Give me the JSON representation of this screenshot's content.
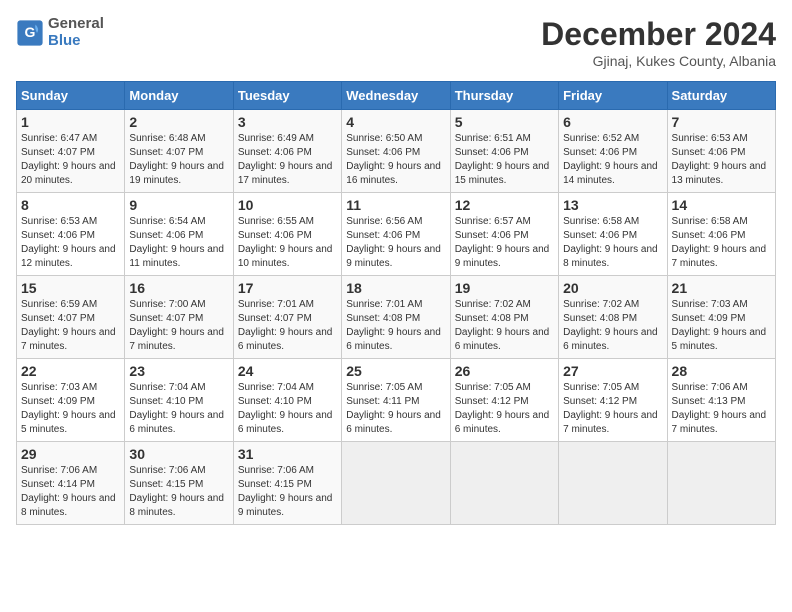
{
  "header": {
    "logo_line1": "General",
    "logo_line2": "Blue",
    "main_title": "December 2024",
    "subtitle": "Gjinaj, Kukes County, Albania"
  },
  "days_of_week": [
    "Sunday",
    "Monday",
    "Tuesday",
    "Wednesday",
    "Thursday",
    "Friday",
    "Saturday"
  ],
  "weeks": [
    [
      {
        "num": "1",
        "rise": "6:47 AM",
        "set": "4:07 PM",
        "daylight": "9 hours and 20 minutes."
      },
      {
        "num": "2",
        "rise": "6:48 AM",
        "set": "4:07 PM",
        "daylight": "9 hours and 19 minutes."
      },
      {
        "num": "3",
        "rise": "6:49 AM",
        "set": "4:06 PM",
        "daylight": "9 hours and 17 minutes."
      },
      {
        "num": "4",
        "rise": "6:50 AM",
        "set": "4:06 PM",
        "daylight": "9 hours and 16 minutes."
      },
      {
        "num": "5",
        "rise": "6:51 AM",
        "set": "4:06 PM",
        "daylight": "9 hours and 15 minutes."
      },
      {
        "num": "6",
        "rise": "6:52 AM",
        "set": "4:06 PM",
        "daylight": "9 hours and 14 minutes."
      },
      {
        "num": "7",
        "rise": "6:53 AM",
        "set": "4:06 PM",
        "daylight": "9 hours and 13 minutes."
      }
    ],
    [
      {
        "num": "8",
        "rise": "6:53 AM",
        "set": "4:06 PM",
        "daylight": "9 hours and 12 minutes."
      },
      {
        "num": "9",
        "rise": "6:54 AM",
        "set": "4:06 PM",
        "daylight": "9 hours and 11 minutes."
      },
      {
        "num": "10",
        "rise": "6:55 AM",
        "set": "4:06 PM",
        "daylight": "9 hours and 10 minutes."
      },
      {
        "num": "11",
        "rise": "6:56 AM",
        "set": "4:06 PM",
        "daylight": "9 hours and 9 minutes."
      },
      {
        "num": "12",
        "rise": "6:57 AM",
        "set": "4:06 PM",
        "daylight": "9 hours and 9 minutes."
      },
      {
        "num": "13",
        "rise": "6:58 AM",
        "set": "4:06 PM",
        "daylight": "9 hours and 8 minutes."
      },
      {
        "num": "14",
        "rise": "6:58 AM",
        "set": "4:06 PM",
        "daylight": "9 hours and 7 minutes."
      }
    ],
    [
      {
        "num": "15",
        "rise": "6:59 AM",
        "set": "4:07 PM",
        "daylight": "9 hours and 7 minutes."
      },
      {
        "num": "16",
        "rise": "7:00 AM",
        "set": "4:07 PM",
        "daylight": "9 hours and 7 minutes."
      },
      {
        "num": "17",
        "rise": "7:01 AM",
        "set": "4:07 PM",
        "daylight": "9 hours and 6 minutes."
      },
      {
        "num": "18",
        "rise": "7:01 AM",
        "set": "4:08 PM",
        "daylight": "9 hours and 6 minutes."
      },
      {
        "num": "19",
        "rise": "7:02 AM",
        "set": "4:08 PM",
        "daylight": "9 hours and 6 minutes."
      },
      {
        "num": "20",
        "rise": "7:02 AM",
        "set": "4:08 PM",
        "daylight": "9 hours and 6 minutes."
      },
      {
        "num": "21",
        "rise": "7:03 AM",
        "set": "4:09 PM",
        "daylight": "9 hours and 5 minutes."
      }
    ],
    [
      {
        "num": "22",
        "rise": "7:03 AM",
        "set": "4:09 PM",
        "daylight": "9 hours and 5 minutes."
      },
      {
        "num": "23",
        "rise": "7:04 AM",
        "set": "4:10 PM",
        "daylight": "9 hours and 6 minutes."
      },
      {
        "num": "24",
        "rise": "7:04 AM",
        "set": "4:10 PM",
        "daylight": "9 hours and 6 minutes."
      },
      {
        "num": "25",
        "rise": "7:05 AM",
        "set": "4:11 PM",
        "daylight": "9 hours and 6 minutes."
      },
      {
        "num": "26",
        "rise": "7:05 AM",
        "set": "4:12 PM",
        "daylight": "9 hours and 6 minutes."
      },
      {
        "num": "27",
        "rise": "7:05 AM",
        "set": "4:12 PM",
        "daylight": "9 hours and 7 minutes."
      },
      {
        "num": "28",
        "rise": "7:06 AM",
        "set": "4:13 PM",
        "daylight": "9 hours and 7 minutes."
      }
    ],
    [
      {
        "num": "29",
        "rise": "7:06 AM",
        "set": "4:14 PM",
        "daylight": "9 hours and 8 minutes."
      },
      {
        "num": "30",
        "rise": "7:06 AM",
        "set": "4:15 PM",
        "daylight": "9 hours and 8 minutes."
      },
      {
        "num": "31",
        "rise": "7:06 AM",
        "set": "4:15 PM",
        "daylight": "9 hours and 9 minutes."
      },
      null,
      null,
      null,
      null
    ]
  ]
}
